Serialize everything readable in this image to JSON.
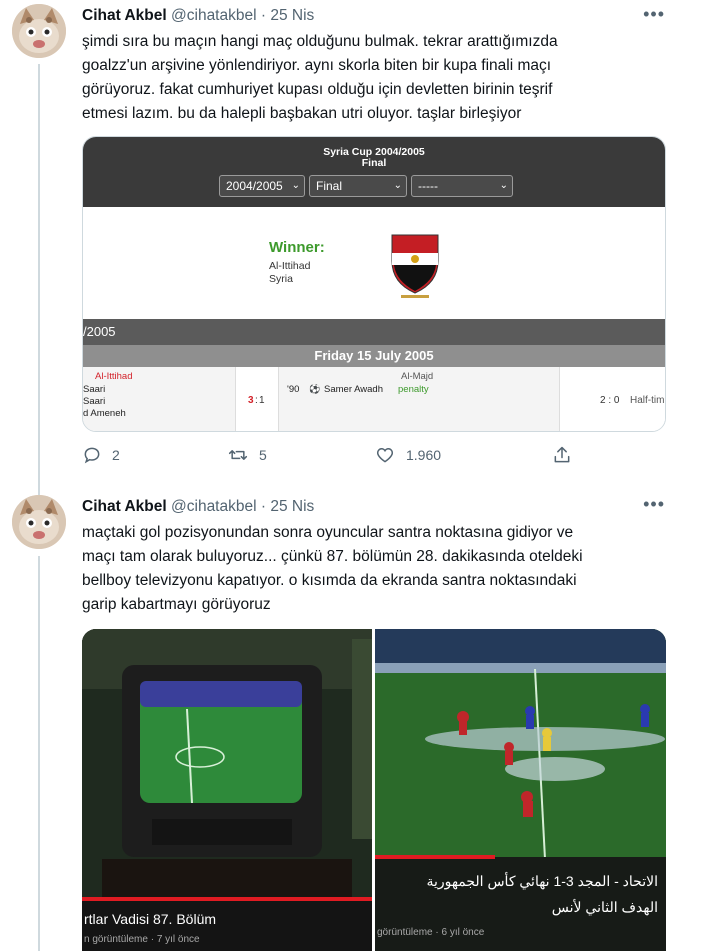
{
  "tweets": [
    {
      "author_name": "Cihat Akbel",
      "handle": "@cihatakbel",
      "separator": "·",
      "date": "25 Nis",
      "more_label": "•••",
      "text_lines": [
        "şimdi sıra bu maçın hangi maç olduğunu bulmak. tekrar arattığımızda",
        "goalzz'un arşivine yönlendiriyor. aynı skorla biten bir kupa finali maçı",
        "görüyoruz. fakat cumhuriyet kupası olduğu için devletten birinin teşrif",
        "etmesi lazım. bu da halepli başbakan utri oluyor. taşlar birleşiyor"
      ],
      "card": {
        "cup_title": "Syria Cup 2004/2005",
        "cup_round": "Final",
        "selects": [
          "2004/2005",
          "Final",
          "-----"
        ],
        "winner_label": "Winner:",
        "winner_team": "Al-Ittihad",
        "winner_country": "Syria",
        "season_bar": "/2005",
        "match_date": "Friday 15 July 2005",
        "home_team": "Al-Ittihad",
        "home_scorers": [
          "Saari",
          "Saari",
          "d Ameneh"
        ],
        "score_home": "3",
        "score_sep": ":",
        "score_away": "1",
        "away_team": "Al-Majd",
        "goal_minute": "'90",
        "goal_scorer": "Samer Awadh",
        "goal_type": "penalty",
        "side_score": "2 : 0",
        "side_label": "Half-tim"
      },
      "replies": "2",
      "retweets": "5",
      "likes": "1.960"
    },
    {
      "author_name": "Cihat Akbel",
      "handle": "@cihatakbel",
      "separator": "·",
      "date": "25 Nis",
      "more_label": "•••",
      "text_lines": [
        "maçtaki gol pozisyonundan sonra oyuncular santra noktasına gidiyor ve",
        "maçı tam olarak buluyoruz... çünkü 87. bölümün 28. dakikasında oteldeki",
        "bellboy televizyonu kapatıyor. o kısımda da ekranda santra noktasındaki",
        "garip kabartmayı görüyoruz"
      ],
      "videos": [
        {
          "title": "rtlar Vadisi 87. Bölüm",
          "meta": "n görüntüleme · 7 yıl önce"
        },
        {
          "title_line1": "الاتحاد - المجد 3-1 نهائي كأس الجمهورية",
          "title_line2": "الهدف الثاني لأنس",
          "meta": "görüntüleme · 6 yıl önce"
        }
      ]
    }
  ],
  "colors": {
    "text": "#0f1419",
    "secondary": "#536471",
    "border": "#cfd9de",
    "winner_green": "#3d9a2c",
    "home_red": "#d3222a"
  },
  "icons": [
    "reply-icon",
    "retweet-icon",
    "like-icon",
    "share-icon",
    "more-icon",
    "soccer-ball-icon",
    "club-crest-icon"
  ]
}
